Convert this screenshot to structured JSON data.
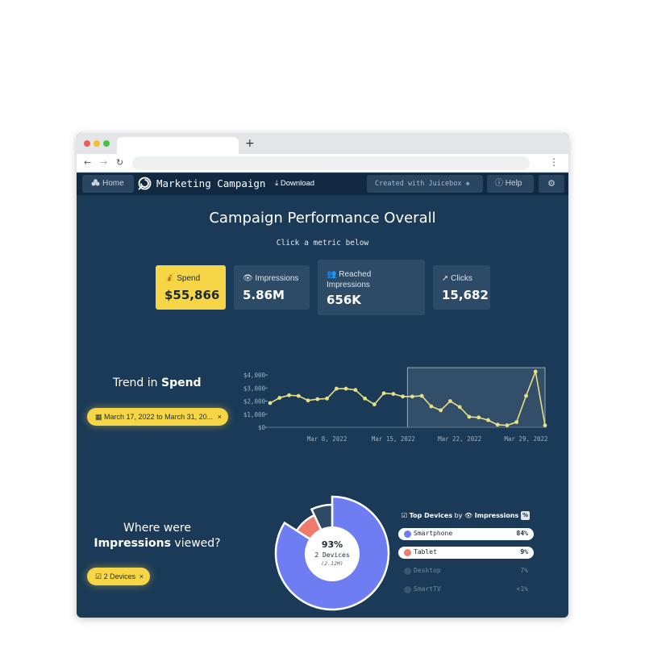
{
  "browser": {
    "new_tab_symbol": "+",
    "back": "←",
    "forward": "→",
    "reload": "↻",
    "menu": "⋮"
  },
  "appbar": {
    "home_label": "Home",
    "title": "Marketing Campaign",
    "download_label": "Download",
    "created_label": "Created with Juicebox",
    "help_label": "Help"
  },
  "header": {
    "title": "Campaign Performance Overall",
    "subtitle": "Click a metric below"
  },
  "metrics": [
    {
      "label": "Spend",
      "value": "$55,866",
      "icon": "money-bag-icon",
      "selected": true
    },
    {
      "label": "Impressions",
      "value": "5.86M",
      "icon": "eye-icon",
      "selected": false
    },
    {
      "label": "Reached Impressions",
      "value": "656K",
      "icon": "users-icon",
      "selected": false
    },
    {
      "label": "Clicks",
      "value": "15,682",
      "icon": "cursor-icon",
      "selected": false
    }
  ],
  "trend": {
    "title_prefix": "Trend in ",
    "title_metric": "Spend",
    "date_filter": "March 17, 2022 to March 31, 20...",
    "close": "×"
  },
  "chart_data": {
    "type": "line",
    "x": [
      "Mar 2",
      "Mar 3",
      "Mar 4",
      "Mar 5",
      "Mar 6",
      "Mar 7",
      "Mar 8",
      "Mar 9",
      "Mar 10",
      "Mar 11",
      "Mar 12",
      "Mar 13",
      "Mar 14",
      "Mar 15",
      "Mar 16",
      "Mar 17",
      "Mar 18",
      "Mar 19",
      "Mar 20",
      "Mar 21",
      "Mar 22",
      "Mar 23",
      "Mar 24",
      "Mar 25",
      "Mar 26",
      "Mar 27",
      "Mar 28",
      "Mar 29",
      "Mar 30",
      "Mar 31"
    ],
    "series": [
      {
        "values": [
          1850,
          2250,
          2450,
          2400,
          2050,
          2150,
          2200,
          2950,
          2950,
          2850,
          2200,
          1750,
          2600,
          2550,
          2350,
          2350,
          2400,
          1600,
          1300,
          2000,
          1550,
          800,
          750,
          550,
          200,
          150,
          400,
          2400,
          4250,
          150
        ]
      }
    ],
    "xtick_labels": [
      "Mar 8, 2022",
      "Mar 15, 2022",
      "Mar 22, 2022",
      "Mar 29, 2022"
    ],
    "ytick_labels": [
      "$0",
      "$1,000",
      "$2,000",
      "$3,000",
      "$4,000"
    ],
    "ylim": [
      0,
      4000
    ],
    "highlight_range": [
      "Mar 17",
      "Mar 31"
    ],
    "color": "#e7df84"
  },
  "devices": {
    "title_line1": "Where were",
    "title_metric": "Impressions",
    "title_line2": " viewed?",
    "filter_label": "2 Devices",
    "close": "×",
    "center_pct": "93%",
    "center_count": "2 Devices",
    "center_total": "(2.12M)",
    "top_label": "Top Devices",
    "by_label": "by",
    "metric_label": "Impressions",
    "pct_toggle": "%",
    "rows": [
      {
        "name": "Smartphone",
        "pct": "84%",
        "color": "#6f7df2",
        "selected": true
      },
      {
        "name": "Tablet",
        "pct": "9%",
        "color": "#ef7b6f",
        "selected": true
      },
      {
        "name": "Desktop",
        "pct": "7%",
        "color": "#3d5670",
        "selected": false
      },
      {
        "name": "SmartTV",
        "pct": "<1%",
        "color": "#3d5670",
        "selected": false
      }
    ]
  },
  "pie_data": {
    "values": [
      84,
      9,
      7
    ],
    "colors": [
      "#6f7df2",
      "#ef7b6f",
      "#2f4a64"
    ]
  }
}
